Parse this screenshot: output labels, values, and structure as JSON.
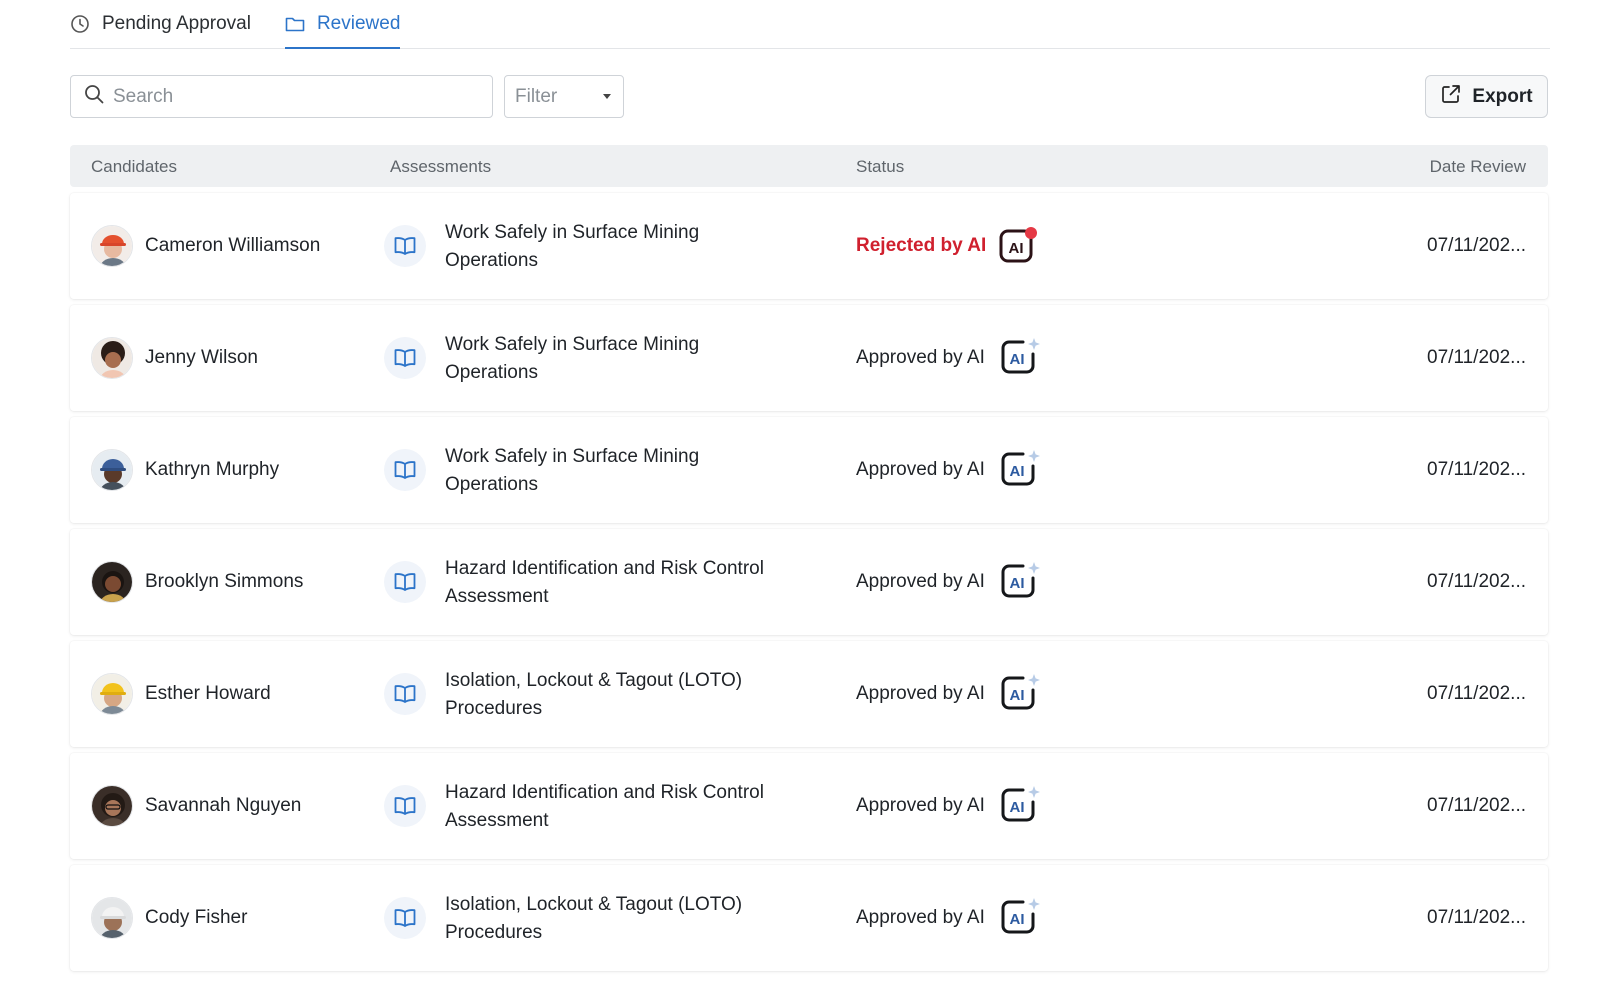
{
  "tabs": [
    {
      "label": "Pending Approval",
      "icon": "clock-icon",
      "active": false
    },
    {
      "label": "Reviewed",
      "icon": "folder-icon",
      "active": true
    }
  ],
  "toolbar": {
    "search_placeholder": "Search",
    "filter_label": "Filter",
    "export_label": "Export"
  },
  "table": {
    "columns": [
      "Candidates",
      "Assessments",
      "Status",
      "Date Review"
    ],
    "rows": [
      {
        "name": "Cameron Williamson",
        "assessment_line1": "Work Safely in Surface Mining",
        "assessment_line2": "Operations",
        "status": "Rejected by AI",
        "status_type": "rejected",
        "date": "07/11/202..."
      },
      {
        "name": "Jenny Wilson",
        "assessment_line1": "Work Safely in Surface Mining",
        "assessment_line2": "Operations",
        "status": "Approved by AI",
        "status_type": "approved",
        "date": "07/11/202..."
      },
      {
        "name": "Kathryn Murphy",
        "assessment_line1": "Work Safely in Surface Mining",
        "assessment_line2": "Operations",
        "status": "Approved by AI",
        "status_type": "approved",
        "date": "07/11/202..."
      },
      {
        "name": "Brooklyn Simmons",
        "assessment_line1": "Hazard Identification and Risk Control",
        "assessment_line2": "Assessment",
        "status": "Approved by AI",
        "status_type": "approved",
        "date": "07/11/202..."
      },
      {
        "name": "Esther Howard",
        "assessment_line1": "Isolation, Lockout & Tagout (LOTO)",
        "assessment_line2": "Procedures",
        "status": "Approved by AI",
        "status_type": "approved",
        "date": "07/11/202..."
      },
      {
        "name": "Savannah Nguyen",
        "assessment_line1": "Hazard Identification and Risk Control",
        "assessment_line2": "Assessment",
        "status": "Approved by AI",
        "status_type": "approved",
        "date": "07/11/202..."
      },
      {
        "name": "Cody Fisher",
        "assessment_line1": "Isolation, Lockout & Tagout (LOTO)",
        "assessment_line2": "Procedures",
        "status": "Approved by AI",
        "status_type": "approved",
        "date": "07/11/202..."
      }
    ]
  },
  "ai_badge_text": "AI",
  "colors": {
    "accent": "#2c74c9",
    "rejected": "#d0202e",
    "header_bg": "#eef0f2"
  }
}
